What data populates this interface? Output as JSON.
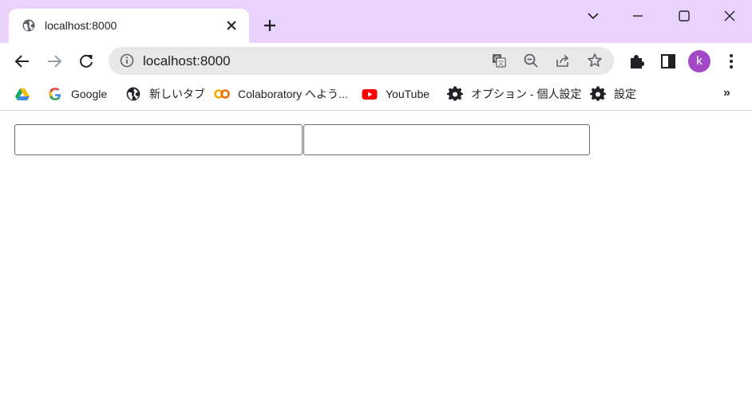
{
  "tab": {
    "title": "localhost:8000"
  },
  "omnibox": {
    "url": "localhost:8000"
  },
  "profile": {
    "initial": "k",
    "color": "#a349c8"
  },
  "bookmarks": [
    {
      "label": ""
    },
    {
      "label": "Google"
    },
    {
      "label": "新しいタブ"
    },
    {
      "label": "Colaboratory へよう..."
    },
    {
      "label": "YouTube"
    },
    {
      "label": "オプション - 個人設定"
    },
    {
      "label": "設定"
    }
  ],
  "bookmarks_overflow": "»",
  "page": {
    "field1": {
      "value": ""
    },
    "field2": {
      "value": ""
    }
  },
  "colors": {
    "titlebar": "#e9d2fb",
    "omnibox": "#e8e8e8"
  }
}
